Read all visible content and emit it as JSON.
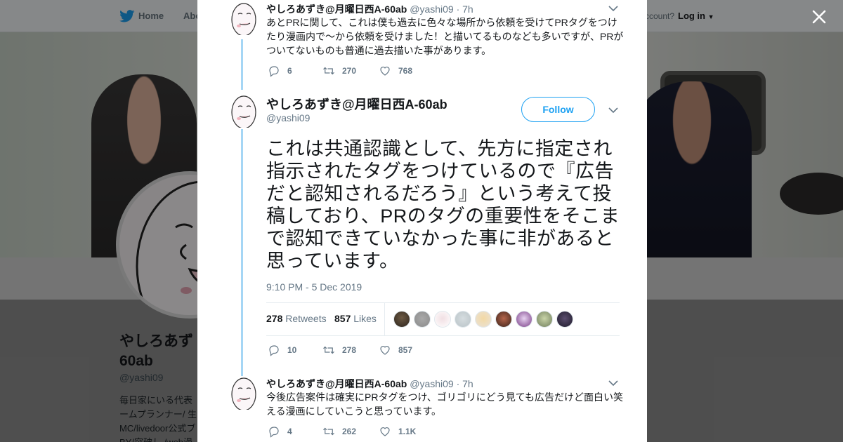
{
  "nav": {
    "home": "Home",
    "about": "Abo",
    "have_account": "ccount?",
    "login": "Log in"
  },
  "profile": {
    "name_line1": "やしろあず",
    "name_line2": "60ab",
    "handle": "@yashi09",
    "bio": "毎日家にいる代表\nームプランナー/ 生\nMC/livedoor公式ブ\nBY/突破し /web漫"
  },
  "tweets": [
    {
      "name": "やしろあずき@月曜日西A-60ab",
      "handle": "@yashi09",
      "time": "· 7h",
      "text": "あとPRに関して、これは僕も過去に色々な場所から依頼を受けてPRタグをつけたり漫画内で〜から依頼を受けました！と描いてるものなども多いですが、PRがついてないものも普通に過去描いた事があります。",
      "replies": "6",
      "retweets": "270",
      "likes": "768"
    },
    {
      "name": "やしろあずき@月曜日西A-60ab",
      "handle": "@yashi09",
      "follow": "Follow",
      "text": "これは共通認識として、先方に指定され指示されたタグをつけているので『広告だと認知されるだろう』という考えて投稿しており、PRのタグの重要性をそこまで認知できていなかった事に非があると思っています。",
      "timestamp": "9:10 PM - 5 Dec 2019",
      "retweet_count": "278",
      "retweet_label": "Retweets",
      "like_count": "857",
      "like_label": "Likes",
      "replies": "10",
      "retweets": "278",
      "likes": "857"
    },
    {
      "name": "やしろあずき@月曜日西A-60ab",
      "handle": "@yashi09",
      "time": "· 7h",
      "text": "今後広告案件は確実にPRタグをつけ、ゴリゴリにどう見ても広告だけど面白い笑える漫画にしていこうと思っています。",
      "replies": "4",
      "retweets": "262",
      "likes": "1.1K"
    }
  ],
  "icons": [
    "twitter-bird-icon",
    "close-icon",
    "reply-icon",
    "retweet-icon",
    "like-icon",
    "chevron-down-icon"
  ],
  "colors": {
    "accent": "#1da1f2",
    "thread_line": "#a5d6f5",
    "muted": "#657786",
    "text": "#14171a"
  }
}
